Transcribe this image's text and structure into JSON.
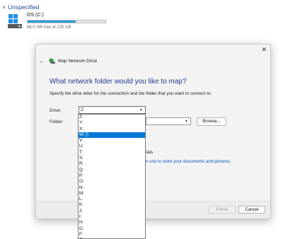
{
  "explorer": {
    "section_title": "Unspecified",
    "drive": {
      "name": "OS (C:)",
      "free_text": "86.0 GB free of 225 GB",
      "used_fraction": 0.62,
      "fill_color": "#26a0da"
    }
  },
  "dialog": {
    "title": "Map Network Drive",
    "heading": "What network folder would you like to map?",
    "description": "Specify the drive letter for the connection and the folder that you want to connect to:",
    "drive_label": "Drive:",
    "drive_value": "Z:",
    "folder_label": "Folder:",
    "folder_value": "",
    "browse_label": "Browse...",
    "credentials_partial": "tials",
    "link_partial": "n use to store your documents and pictures",
    "link_suffix": ".",
    "finish_label": "Finish",
    "cancel_label": "Cancel",
    "accent_color": "#0078d7"
  },
  "dropdown": {
    "options": [
      {
        "label": "Z:"
      },
      {
        "label": "Y:"
      },
      {
        "label": "X:"
      },
      {
        "label": "W: (\\"
      },
      {
        "label": "V:"
      },
      {
        "label": "U:"
      },
      {
        "label": "T:"
      },
      {
        "label": "S:"
      },
      {
        "label": "R:"
      },
      {
        "label": "Q:"
      },
      {
        "label": "P:"
      },
      {
        "label": "O:"
      },
      {
        "label": "N:"
      },
      {
        "label": "M:"
      },
      {
        "label": "L:"
      },
      {
        "label": "K:"
      },
      {
        "label": "J:"
      },
      {
        "label": "I:"
      },
      {
        "label": "H:"
      },
      {
        "label": "G:"
      },
      {
        "label": "F:"
      },
      {
        "label": "E:"
      }
    ],
    "selected_index": 3
  }
}
